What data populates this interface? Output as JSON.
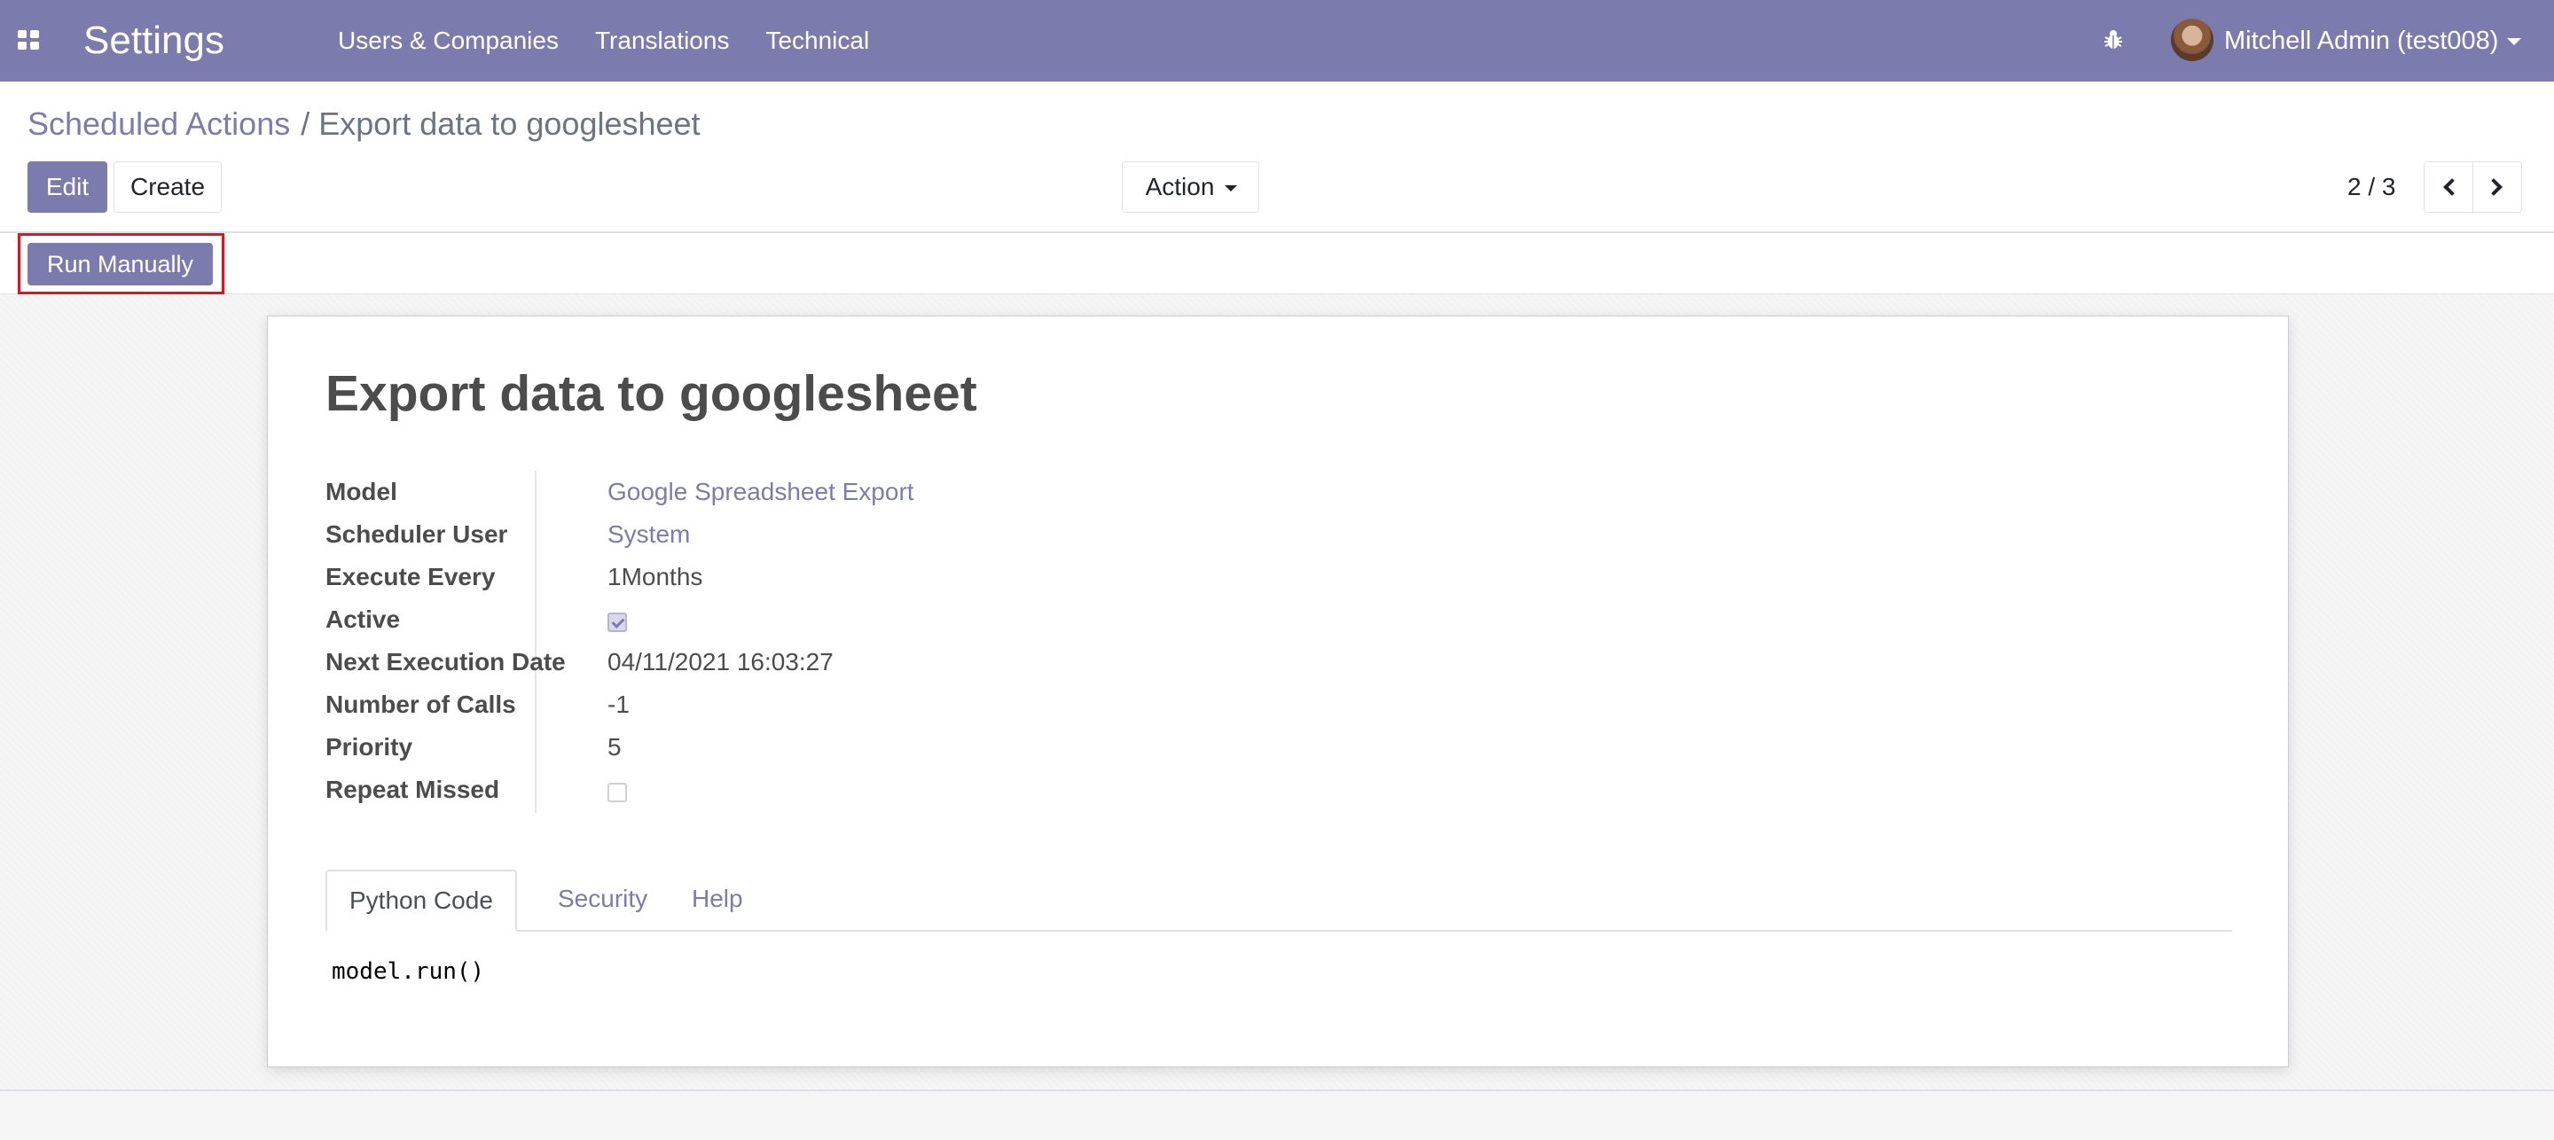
{
  "navbar": {
    "app_title": "Settings",
    "menu": [
      "Users & Companies",
      "Translations",
      "Technical"
    ],
    "user_name": "Mitchell Admin (test008)",
    "icons": {
      "apps": "apps-grid-icon",
      "debug": "bug-icon",
      "caret": "chevron-down-icon"
    }
  },
  "breadcrumb": {
    "parent": "Scheduled Actions",
    "separator": "/",
    "current": "Export data to googlesheet"
  },
  "toolbar": {
    "edit_label": "Edit",
    "create_label": "Create",
    "action_label": "Action",
    "pager": "2 / 3"
  },
  "statusbar": {
    "run_label": "Run Manually"
  },
  "record": {
    "title": "Export data to googlesheet",
    "fields": {
      "model": {
        "label": "Model",
        "value": "Google Spreadsheet Export"
      },
      "scheduler_user": {
        "label": "Scheduler User",
        "value": "System"
      },
      "execute_every": {
        "label": "Execute Every",
        "value": "1Months"
      },
      "active": {
        "label": "Active",
        "checked": true
      },
      "next_execution": {
        "label": "Next Execution Date",
        "value": "04/11/2021 16:03:27"
      },
      "number_of_calls": {
        "label": "Number of Calls",
        "value": "-1"
      },
      "priority": {
        "label": "Priority",
        "value": "5"
      },
      "repeat_missed": {
        "label": "Repeat Missed",
        "checked": false
      }
    },
    "tabs": [
      "Python Code",
      "Security",
      "Help"
    ],
    "active_tab": "Python Code",
    "code": "model.run()"
  },
  "colors": {
    "brand": "#7c7bad",
    "highlight": "#e0141e"
  }
}
